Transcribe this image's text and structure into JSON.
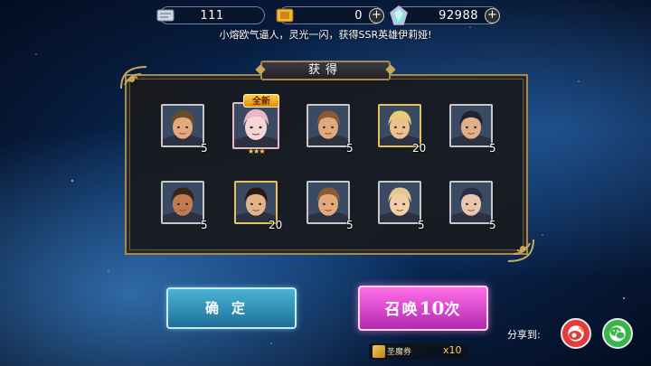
{
  "currency": {
    "scrolls": "111",
    "tickets": "0",
    "gems": "92988"
  },
  "announcement": "小熔欧气逼人，灵光一闪，获得SSR英雄伊莉娅!",
  "panel": {
    "title": "获得",
    "new_badge": "全新",
    "items": [
      {
        "count": "5",
        "frame": "silver",
        "skin": "#e3a87c",
        "hair": "#6b4a2a"
      },
      {
        "count": "",
        "frame": "pink",
        "skin": "#f3d6d6",
        "hair": "#e8b8c8",
        "is_new": true
      },
      {
        "count": "5",
        "frame": "silver",
        "skin": "#e3a87c",
        "hair": "#8a5a30"
      },
      {
        "count": "20",
        "frame": "gold",
        "skin": "#eac08f",
        "hair": "#e6cc72"
      },
      {
        "count": "5",
        "frame": "silver",
        "skin": "#e0b08a",
        "hair": "#1d2430"
      },
      {
        "count": "5",
        "frame": "silver",
        "skin": "#c27a52",
        "hair": "#3a2416"
      },
      {
        "count": "20",
        "frame": "gold",
        "skin": "#e2b28a",
        "hair": "#2a1a12"
      },
      {
        "count": "5",
        "frame": "silver",
        "skin": "#e3a87c",
        "hair": "#8a5a30"
      },
      {
        "count": "5",
        "frame": "silver",
        "skin": "#f0cfa8",
        "hair": "#e4c98a"
      },
      {
        "count": "5",
        "frame": "silver",
        "skin": "#e9c6b0",
        "hair": "#2a2c4a"
      }
    ]
  },
  "buttons": {
    "confirm": "确定",
    "summon_prefix": "召唤",
    "summon_count": "10",
    "summon_suffix": "次"
  },
  "ticket": {
    "label": "圣魔券",
    "count": "x10"
  },
  "share": {
    "label": "分享到:"
  },
  "colors": {
    "gold_border": "#a3894d",
    "confirm_button": "#2f8fbd",
    "summon_button": "#d94ad0"
  }
}
